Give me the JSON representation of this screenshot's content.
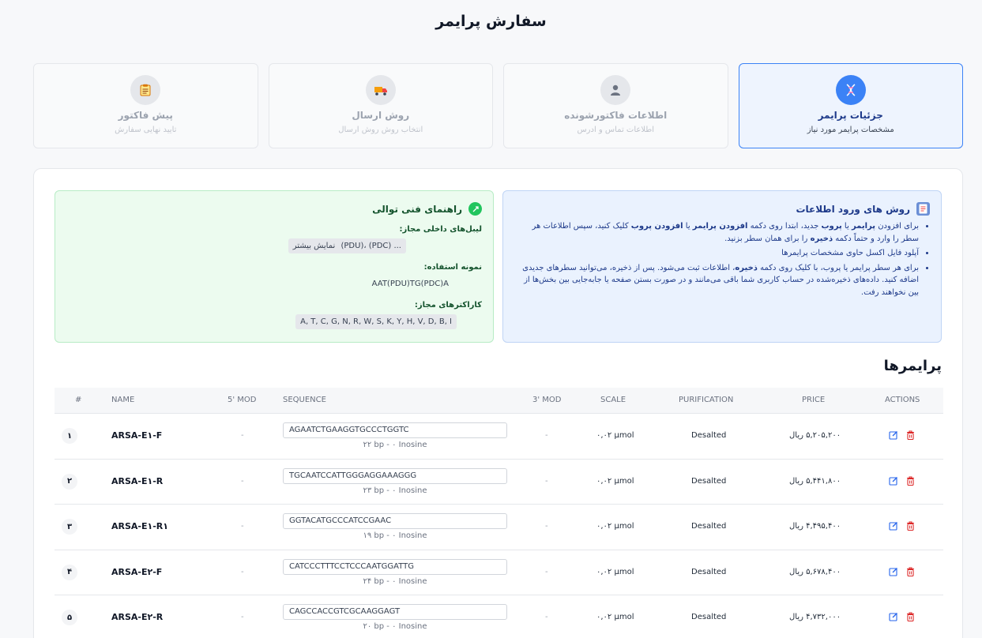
{
  "page_title": "سفارش پرایمر",
  "steps": [
    {
      "title": "جزئیات پرایمر",
      "subtitle": "مشخصات پرایمر مورد نیاز",
      "icon": "dna-icon",
      "active": true
    },
    {
      "title": "اطلاعات فاکتورشونده",
      "subtitle": "اطلاعات تماس و ادرس",
      "icon": "user-icon",
      "active": false
    },
    {
      "title": "روش ارسال",
      "subtitle": "انتخاب روش روش ارسال",
      "icon": "truck-icon",
      "active": false
    },
    {
      "title": "پیش فاکتور",
      "subtitle": "تایید نهایی سفارش",
      "icon": "clipboard-icon",
      "active": false
    }
  ],
  "info": {
    "title": "روش های ورود اطلاعات",
    "item1": {
      "a": "برای افزودن ",
      "b": "پرایمر",
      "c": " یا ",
      "d": "پروب",
      "e": " جدید، ابتدا روی دکمه ",
      "f": "افزودن پرایمر",
      "g": " یا ",
      "h": "افزودن پروب",
      "i": " کلیک کنید، سپس اطلاعات هر سطر را وارد و حتماً دکمه ",
      "j": "ذخیره",
      "k": " را برای همان سطر بزنید."
    },
    "item2": "آپلود فایل اکسل حاوی مشخصات پرایمرها",
    "item3": {
      "a": "برای هر سطر پرایمر یا پروب، با کلیک روی دکمه ",
      "b": "ذخیره",
      "c": "، اطلاعات ثبت می‌شود. پس از ذخیره، می‌توانید سطرهای جدیدی اضافه کنید. داده‌های ذخیره‌شده در حساب کاربری شما باقی می‌مانند و در صورت بستن صفحه یا جابه‌جایی بین بخش‌ها از بین نخواهند رفت."
    }
  },
  "tech": {
    "title": "راهنمای فنی توالی",
    "labels_title": "لیبل‌های داخلی مجاز:",
    "labels_value": "(PDU)، (PDC) ...",
    "labels_more": "نمایش بیشتر",
    "example_title": "نمونه استفاده:",
    "example_value": "AAT(PDU)TG(PDC)A",
    "chars_title": "کاراکترهای مجاز:",
    "chars_value": "A, T, C, G, N, R, W, S, K, Y, H, V, D, B, I"
  },
  "section_title": "پرایمرها",
  "table": {
    "headers": {
      "idx": "#",
      "name": "NAME",
      "mod5": "5' MOD",
      "sequence": "SEQUENCE",
      "mod3": "3' MOD",
      "scale": "SCALE",
      "purification": "PURIFICATION",
      "price": "PRICE",
      "actions": "ACTIONS"
    },
    "rows": [
      {
        "idx": "۱",
        "name": "ARSA-E۱-F",
        "mod5": "-",
        "sequence": "AGAATCTGAAGGTGCCCTGGTC",
        "meta": "۲۲ bp - ۰ Inosine",
        "mod3": "-",
        "scale": "۰,۰۲ µmol",
        "purification": "Desalted",
        "price": "۵,۲۰۵,۲۰۰ ریال"
      },
      {
        "idx": "۲",
        "name": "ARSA-E۱-R",
        "mod5": "-",
        "sequence": "TGCAATCCATTGGGAGGAAAGGG",
        "meta": "۲۳ bp - ۰ Inosine",
        "mod3": "-",
        "scale": "۰,۰۲ µmol",
        "purification": "Desalted",
        "price": "۵,۴۴۱,۸۰۰ ریال"
      },
      {
        "idx": "۳",
        "name": "ARSA-E۱-R۱",
        "mod5": "-",
        "sequence": "GGTACATGCCCATCCGAAC",
        "meta": "۱۹ bp - ۰ Inosine",
        "mod3": "-",
        "scale": "۰,۰۲ µmol",
        "purification": "Desalted",
        "price": "۴,۴۹۵,۴۰۰ ریال"
      },
      {
        "idx": "۴",
        "name": "ARSA-E۲-F",
        "mod5": "-",
        "sequence": "CATCCCTTTCCTCCCAATGGATTG",
        "meta": "۲۴ bp - ۰ Inosine",
        "mod3": "-",
        "scale": "۰,۰۲ µmol",
        "purification": "Desalted",
        "price": "۵,۶۷۸,۴۰۰ ریال"
      },
      {
        "idx": "۵",
        "name": "ARSA-E۲-R",
        "mod5": "-",
        "sequence": "CAGCCACCGTCGCAAGGAGT",
        "meta": "۲۰ bp - ۰ Inosine",
        "mod3": "-",
        "scale": "۰,۰۲ µmol",
        "purification": "Desalted",
        "price": "۴,۷۳۲,۰۰۰ ریال"
      }
    ]
  },
  "colors": {
    "primary": "#3b82f6",
    "edit": "#2563eb",
    "delete": "#dc2626"
  }
}
